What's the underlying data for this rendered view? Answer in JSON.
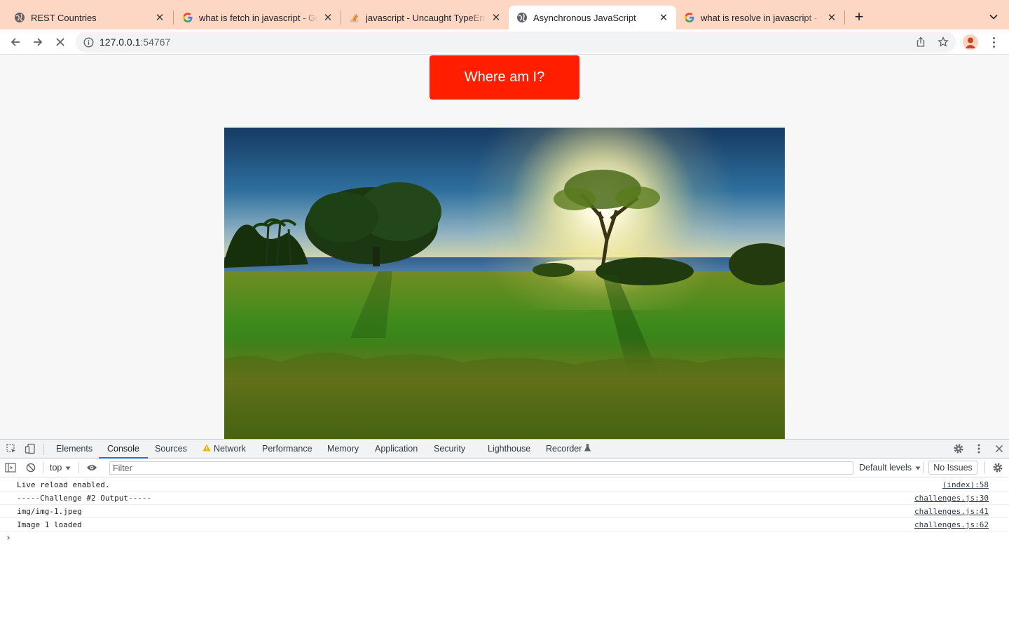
{
  "browser": {
    "tabs": [
      {
        "title": "REST Countries",
        "favicon": "globe-icon",
        "active": false
      },
      {
        "title": "what is fetch in javascript - Google Search",
        "favicon": "google-icon",
        "active": false
      },
      {
        "title": "javascript - Uncaught TypeError",
        "favicon": "stackoverflow-icon",
        "active": false
      },
      {
        "title": "Asynchronous JavaScript",
        "favicon": "globe-icon",
        "active": true
      },
      {
        "title": "what is resolve in javascript - Google Search",
        "favicon": "google-icon",
        "active": false
      }
    ],
    "new_tab_label": "+",
    "url_host": "127.0.0.1",
    "url_port": ":54767"
  },
  "page": {
    "button_label": "Where am I?",
    "image_alt": "img/img-1.jpeg"
  },
  "devtools": {
    "tabs": [
      "Elements",
      "Console",
      "Sources",
      "Network",
      "Performance",
      "Memory",
      "Application",
      "Security",
      "Lighthouse",
      "Recorder"
    ],
    "active_tab": "Console",
    "context": "top",
    "filter_placeholder": "Filter",
    "levels_label": "Default levels",
    "issues_label": "No Issues",
    "logs": [
      {
        "message": "Live reload enabled.",
        "source": "(index):58"
      },
      {
        "message": "-----Challenge #2 Output-----",
        "source": "challenges.js:30"
      },
      {
        "message": "img/img-1.jpeg",
        "source": "challenges.js:41"
      },
      {
        "message": "Image 1 loaded",
        "source": "challenges.js:62"
      }
    ],
    "prompt_glyph": "›"
  },
  "colors": {
    "tabstrip": "#fdd7c4",
    "button": "#ff1f00",
    "devtools_accent": "#1a73e8"
  }
}
